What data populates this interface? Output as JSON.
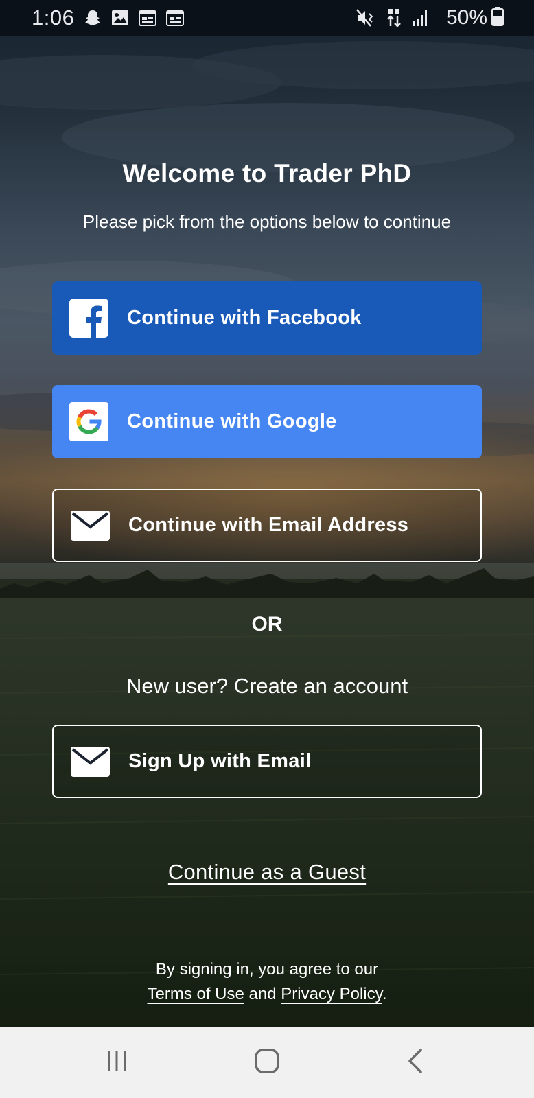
{
  "status_bar": {
    "time": "1:06",
    "battery_percent": "50%",
    "left_icons": [
      "snapchat-icon",
      "gallery-icon",
      "calendar-icon",
      "calendar-icon"
    ],
    "right_icons": [
      "mute-vibrate-icon",
      "data-transfer-icon",
      "signal-icon",
      "battery-icon"
    ]
  },
  "welcome": {
    "title": "Welcome to Trader PhD",
    "subtitle": "Please pick from the options below to continue"
  },
  "buttons": {
    "facebook": {
      "label": "Continue with Facebook",
      "icon": "facebook-icon",
      "color": "#1959b8"
    },
    "google": {
      "label": "Continue with Google",
      "icon": "google-icon",
      "color": "#4586f2"
    },
    "email": {
      "label": "Continue with Email Address",
      "icon": "envelope-icon"
    },
    "signup": {
      "label": "Sign Up with Email",
      "icon": "envelope-icon"
    }
  },
  "divider": {
    "text": "OR"
  },
  "new_user": {
    "text": "New user? Create an account"
  },
  "guest": {
    "label": "Continue as a Guest"
  },
  "legal": {
    "line1": "By signing in, you agree to our",
    "terms": "Terms of Use",
    "and": "and",
    "privacy": "Privacy Policy",
    "period": "."
  },
  "nav_bar": {
    "icons": [
      "recent-apps-icon",
      "home-icon",
      "back-icon"
    ]
  }
}
